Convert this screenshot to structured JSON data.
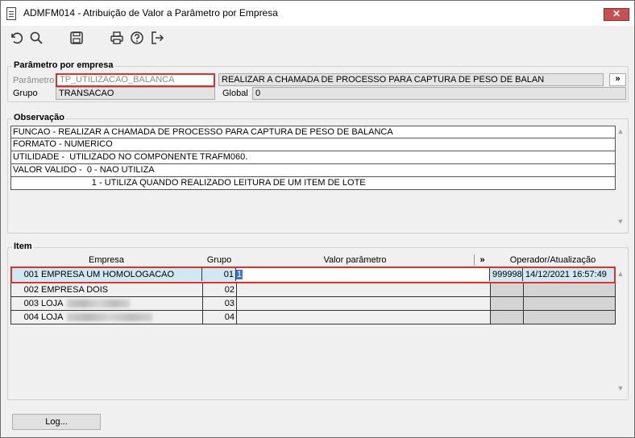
{
  "window": {
    "title": "ADMFM014 - Atribuição de Valor a Parâmetro por Empresa",
    "close_label": "✕"
  },
  "toolbar": {
    "icons": [
      "undo-icon",
      "search-icon",
      "save-icon",
      "print-icon",
      "help-icon",
      "exit-icon"
    ]
  },
  "param_group": {
    "title": "Parâmetro por empresa",
    "parametro_label": "Parâmetro",
    "parametro_value": "TP_UTILIZACAO_BALANCA",
    "descricao_value": "REALIZAR A CHAMADA DE PROCESSO PARA CAPTURA DE PESO DE BALAN",
    "more_label": "»",
    "grupo_label": "Grupo",
    "grupo_value": "TRANSACAO",
    "global_label": "Global",
    "global_value": "0"
  },
  "observacao": {
    "title": "Observação",
    "lines": [
      "FUNCAO - REALIZAR A CHAMADA DE PROCESSO PARA CAPTURA DE PESO DE BALANCA",
      "FORMATO - NUMERICO",
      "UTILIDADE -  UTILIZADO NO COMPONENTE TRAFM060.",
      "VALOR VALIDO -  0 - NAO UTILIZA",
      "                                1 - UTILIZA QUANDO REALIZADO LEITURA DE UM ITEM DE LOTE"
    ]
  },
  "item": {
    "title": "Item",
    "headers": {
      "empresa": "Empresa",
      "grupo": "Grupo",
      "valor": "Valor parâmetro",
      "more": "»",
      "operador": "Operador/Atualização"
    },
    "rows": [
      {
        "code": "001",
        "name": "EMPRESA UM HOMOLOGACAO",
        "grupo": "01",
        "valor": "1",
        "operador": "999998",
        "atualizacao": "14/12/2021 16:57:49"
      },
      {
        "code": "002",
        "name": "EMPRESA DOIS",
        "grupo": "02",
        "valor": "",
        "operador": "",
        "atualizacao": ""
      },
      {
        "code": "003",
        "name": "LOJA",
        "grupo": "03",
        "valor": "",
        "operador": "",
        "atualizacao": ""
      },
      {
        "code": "004",
        "name": "LOJA",
        "grupo": "04",
        "valor": "",
        "operador": "",
        "atualizacao": ""
      }
    ]
  },
  "footer": {
    "log_label": "Log..."
  },
  "colors": {
    "highlight_border": "#d9322b",
    "selected_row": "#cfe8f3",
    "close_button": "#c75050"
  }
}
